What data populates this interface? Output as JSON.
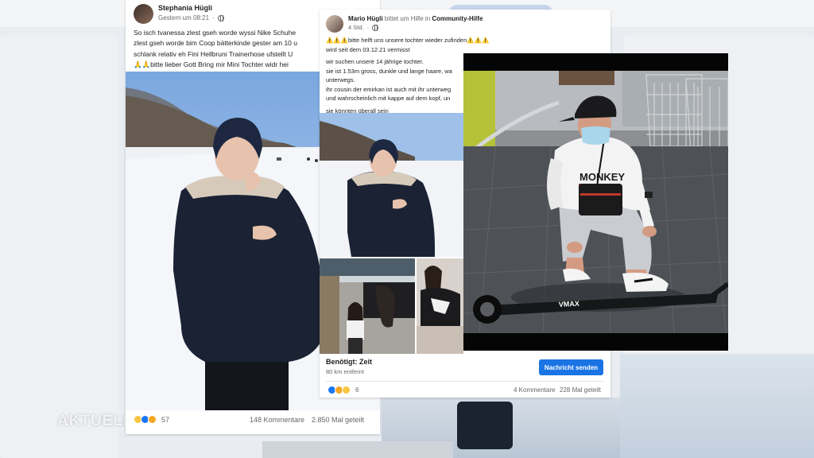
{
  "watermark": "AKTUELL",
  "post1": {
    "author": "Stephania Hügli",
    "timestamp": "Gestern um 08:21",
    "privacy_icon": "globe-icon",
    "text_lines": [
      "So isch tvanessa zlest gseh worde wyssi Nike Schuhe",
      "zlest gseh worde bim Coop bätterkinde gester am 10 u",
      "schlank relativ eh Fini Hellbruni Trainerhose ufstellt U",
      "🙏🙏bitte lieber Gott Bring mir Mini Tochter widr hei"
    ],
    "reaction_count": "57",
    "comments": "148 Kommentare",
    "shares": "2.850 Mal geteilt"
  },
  "post2": {
    "author": "Mario Hügli",
    "action": "bittet um Hilfe in",
    "group": "Community-Hilfe",
    "timestamp": "4 Std.",
    "privacy_icon": "globe-icon",
    "text_lines": [
      "⚠️⚠️⚠️bitte helft uns unsere tochter wieder zufinden⚠️⚠️⚠️",
      "wird seit dem 03.12.21 vermisst"
    ],
    "text_lines_b": [
      "wir suchen unsere 14 jährige tochter.",
      "sie ist 1.53m gross, dunkle und lange haare, wa",
      "unterwegs.",
      "ihr cousin der emirkan ist auch mit ihr unterweg",
      "und wahrscheinlich mit kappe auf dem kopf, un"
    ],
    "text_line_c": "sie könnten überall sein",
    "need_title": "Benötigt: Zeit",
    "need_distance": "80 km entfernt",
    "message_button": "Nachricht senden",
    "reaction_count": "6",
    "comments": "4 Kommentare",
    "shares": "228 Mal geteilt"
  },
  "overlay": {
    "hoodie_text": "MONKEY",
    "scooter_text": "VMAX"
  }
}
